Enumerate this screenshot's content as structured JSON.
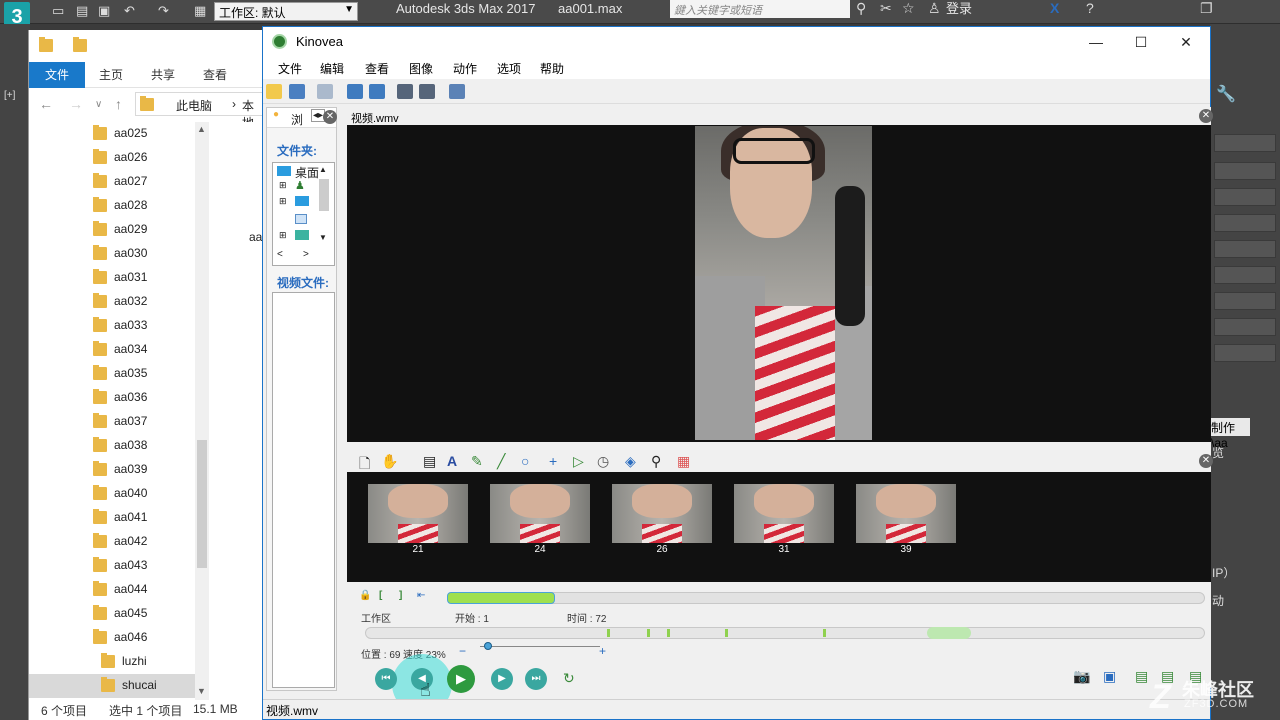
{
  "max": {
    "workspace_label": "工作区: 默认",
    "app_title": "Autodesk 3ds Max 2017",
    "file_name": "aa001.max",
    "search_placeholder": "鍵入关键字或短语",
    "login_label": "登录",
    "side_text1": "制作\\aa",
    "side_text2": "览",
    "side_text3": "IP）",
    "side_text4": "动",
    "viewport_label": "[+]"
  },
  "explorer": {
    "tabs": [
      "文件",
      "主页",
      "共享",
      "查看"
    ],
    "breadcrumb": [
      "此电脑",
      "本地"
    ],
    "items": [
      {
        "label": "aa025"
      },
      {
        "label": "aa026"
      },
      {
        "label": "aa027"
      },
      {
        "label": "aa028"
      },
      {
        "label": "aa029"
      },
      {
        "label": "aa030"
      },
      {
        "label": "aa031"
      },
      {
        "label": "aa032"
      },
      {
        "label": "aa033"
      },
      {
        "label": "aa034"
      },
      {
        "label": "aa035"
      },
      {
        "label": "aa036"
      },
      {
        "label": "aa037"
      },
      {
        "label": "aa038"
      },
      {
        "label": "aa039"
      },
      {
        "label": "aa040"
      },
      {
        "label": "aa041"
      },
      {
        "label": "aa042"
      },
      {
        "label": "aa043"
      },
      {
        "label": "aa044"
      },
      {
        "label": "aa045"
      },
      {
        "label": "aa046"
      },
      {
        "label": "luzhi"
      },
      {
        "label": "shucai"
      }
    ],
    "selected_index": 23,
    "right_pane_text": "aa",
    "status_count": "6 个项目",
    "status_selected": "选中 1 个项目",
    "status_size": "15.1 MB"
  },
  "kinovea": {
    "title": "Kinovea",
    "menu": [
      "文件",
      "编辑",
      "查看",
      "图像",
      "动作",
      "选项",
      "帮助"
    ],
    "left_tab": "浏",
    "folders_label": "文件夹:",
    "tree_root": "桌面",
    "video_files_label": "视频文件:",
    "player_file": "视频.wmv",
    "thumbnails": [
      "21",
      "24",
      "26",
      "31",
      "39"
    ],
    "working_zone_label": "工作区",
    "start_label": "开始 : 1",
    "duration_label": "时间 : 72",
    "position_label": "位置 : 69",
    "speed_label": "速度 23%",
    "speed_percent": 23,
    "status_file": "视频.wmv"
  },
  "watermark": {
    "logo_letter": "Z",
    "brand": "朱峰社区",
    "url": "ZF3D.COM"
  }
}
